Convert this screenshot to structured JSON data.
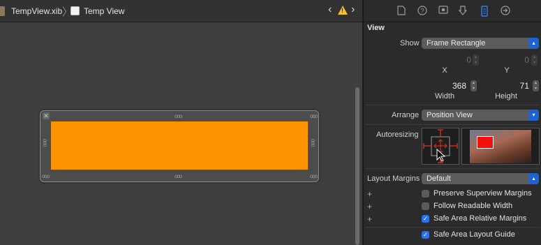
{
  "jumpbar": {
    "file": "TempView.xib",
    "view": "Temp View",
    "back_icon": "chevron-left-icon",
    "forward_icon": "chevron-right-icon",
    "warning_icon": "warning-icon"
  },
  "inspector": {
    "tabs": [
      "file-icon",
      "help-icon",
      "identity-icon",
      "attributes-icon",
      "size-icon",
      "connections-icon"
    ],
    "active_tab": "size-icon",
    "section": "View",
    "show": {
      "label": "Show",
      "value": "Frame Rectangle"
    },
    "x": {
      "value": "0",
      "label": "X"
    },
    "y": {
      "value": "0",
      "label": "Y"
    },
    "width": {
      "value": "368",
      "label": "Width"
    },
    "height": {
      "value": "71",
      "label": "Height"
    },
    "arrange": {
      "label": "Arrange",
      "value": "Position View"
    },
    "autoresizing": {
      "label": "Autoresizing"
    },
    "layout_margins": {
      "label": "Layout Margins",
      "value": "Default"
    },
    "checkboxes": [
      {
        "label": "Preserve Superview Margins",
        "checked": false
      },
      {
        "label": "Follow Readable Width",
        "checked": false
      },
      {
        "label": "Safe Area Relative Margins",
        "checked": true
      },
      {
        "label": "Safe Area Layout Guide",
        "checked": true
      }
    ],
    "plus": "+",
    "checkmark": "✓"
  },
  "colors": {
    "view_fill": "#fe9400",
    "accent": "#2b72ea",
    "constraint_red": "#e0321f"
  }
}
